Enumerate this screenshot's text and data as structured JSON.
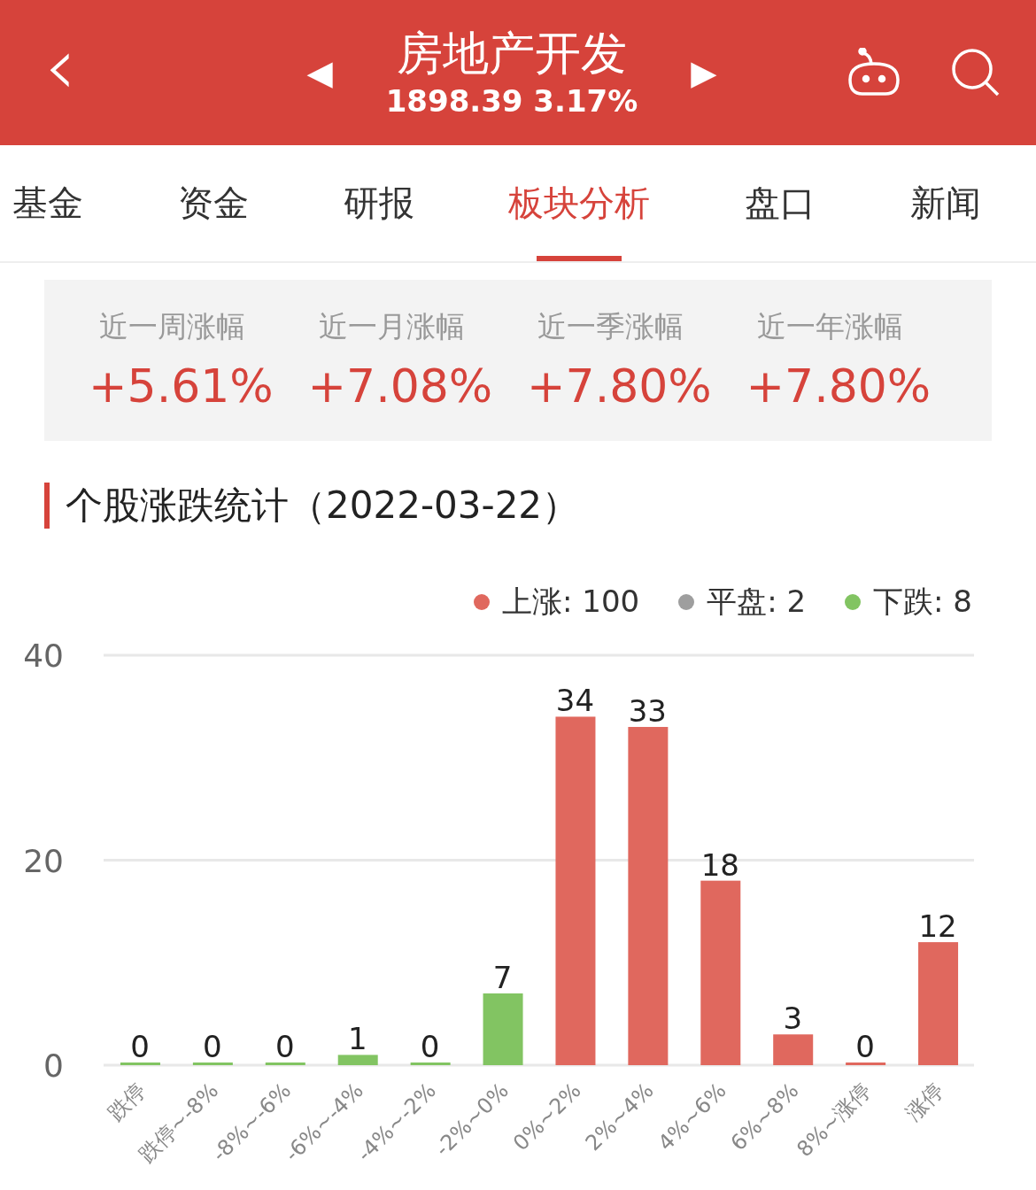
{
  "header": {
    "back_icon": "‹",
    "prev": "◀",
    "next": "▶",
    "title": "房地产开发",
    "subtitle": "1898.39 3.17%"
  },
  "tabs": [
    {
      "label": "基金",
      "selected": false
    },
    {
      "label": "资金",
      "selected": false
    },
    {
      "label": "研报",
      "selected": false
    },
    {
      "label": "板块分析",
      "selected": true
    },
    {
      "label": "盘口",
      "selected": false
    },
    {
      "label": "新闻",
      "selected": false
    }
  ],
  "stats": [
    {
      "label": "近一周涨幅",
      "value": "+5.61%"
    },
    {
      "label": "近一月涨幅",
      "value": "+7.08%"
    },
    {
      "label": "近一季涨幅",
      "value": "+7.80%"
    },
    {
      "label": "近一年涨幅",
      "value": "+7.80%"
    }
  ],
  "section_title": "个股涨跌统计（2022-03-22）",
  "legend": [
    {
      "label": "上涨: 100",
      "color": "#e0685e"
    },
    {
      "label": "平盘: 2",
      "color": "#9e9e9e"
    },
    {
      "label": "下跌: 8",
      "color": "#82c462"
    }
  ],
  "chart_data": {
    "type": "bar",
    "categories": [
      "跌停",
      "跌停~-8%",
      "-8%~-6%",
      "-6%~-4%",
      "-4%~-2%",
      "-2%~0%",
      "0%~2%",
      "2%~4%",
      "4%~6%",
      "6%~8%",
      "8%~涨停",
      "涨停"
    ],
    "series": [
      {
        "color": "#82c462",
        "values": [
          0,
          0,
          0,
          1,
          0,
          7,
          null,
          null,
          null,
          null,
          null,
          null
        ]
      },
      {
        "color": "#e0685e",
        "values": [
          null,
          null,
          null,
          null,
          null,
          null,
          34,
          33,
          18,
          3,
          0,
          12
        ]
      }
    ],
    "ylim": [
      0,
      40
    ],
    "yticks": [
      0,
      20,
      40
    ],
    "data_labels": true
  }
}
